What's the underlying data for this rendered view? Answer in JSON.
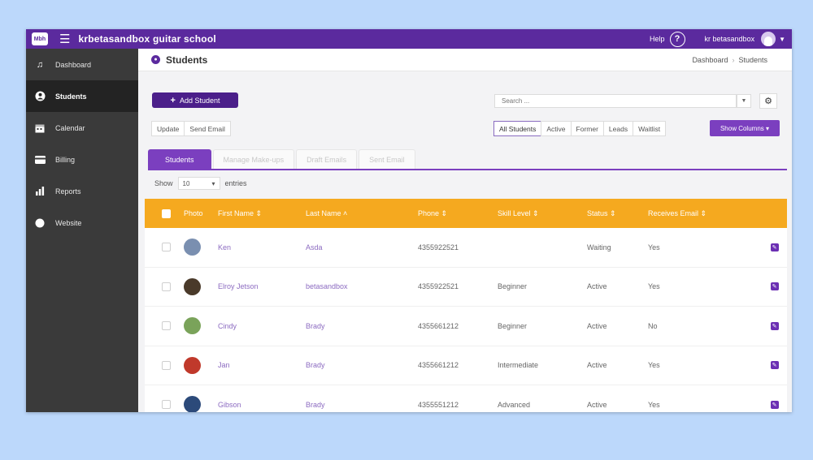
{
  "app": {
    "logo_text": "Mbh",
    "title": "krbetasandbox guitar school",
    "help_label": "Help",
    "user_name": "kr betasandbox"
  },
  "sidebar": {
    "items": [
      {
        "label": "Dashboard",
        "icon": "music-note-icon",
        "active": false
      },
      {
        "label": "Students",
        "icon": "user-circle-icon",
        "active": true
      },
      {
        "label": "Calendar",
        "icon": "calendar-icon",
        "active": false
      },
      {
        "label": "Billing",
        "icon": "credit-card-icon",
        "active": false
      },
      {
        "label": "Reports",
        "icon": "bar-chart-icon",
        "active": false
      },
      {
        "label": "Website",
        "icon": "globe-icon",
        "active": false
      }
    ]
  },
  "page": {
    "title": "Students",
    "breadcrumb": [
      "Dashboard",
      "Students"
    ]
  },
  "toolbar": {
    "add_student_label": "Add Student",
    "search_placeholder": "Search ...",
    "update_label": "Update",
    "send_email_label": "Send Email",
    "filters": [
      "All Students",
      "Active",
      "Former",
      "Leads",
      "Waitlist"
    ],
    "selected_filter": "All Students",
    "show_columns_label": "Show Columns ▾"
  },
  "tabs": [
    "Students",
    "Manage Make-ups",
    "Draft Emails",
    "Sent Email"
  ],
  "entries": {
    "show_label": "Show",
    "value": "10",
    "suffix_label": "entries"
  },
  "table": {
    "headers": [
      "Photo",
      "First Name ⇕",
      "Last Name ˄",
      "Phone ⇕",
      "Skill Level ⇕",
      "Status ⇕",
      "Receives Email ⇕"
    ],
    "rows": [
      {
        "first": "Ken",
        "last": "Asda",
        "phone": "4355922521",
        "skill": "",
        "status": "Waiting",
        "email": "Yes",
        "avatar_color": "#7a8fb0"
      },
      {
        "first": "Elroy Jetson",
        "last": "betasandbox",
        "phone": "4355922521",
        "skill": "Beginner",
        "status": "Active",
        "email": "Yes",
        "avatar_color": "#4a3a2a"
      },
      {
        "first": "Cindy",
        "last": "Brady",
        "phone": "4355661212",
        "skill": "Beginner",
        "status": "Active",
        "email": "No",
        "avatar_color": "#7aa35a"
      },
      {
        "first": "Jan",
        "last": "Brady",
        "phone": "4355661212",
        "skill": "Intermediate",
        "status": "Active",
        "email": "Yes",
        "avatar_color": "#c0392b"
      },
      {
        "first": "Gibson",
        "last": "Brady",
        "phone": "4355551212",
        "skill": "Advanced",
        "status": "Active",
        "email": "Yes",
        "avatar_color": "#2c4a7a"
      }
    ]
  },
  "colors": {
    "brand_purple": "#5b2a9e",
    "accent_purple": "#7b3fbf",
    "table_header": "#f5a91f",
    "sidebar_bg": "#3a3a3a"
  }
}
